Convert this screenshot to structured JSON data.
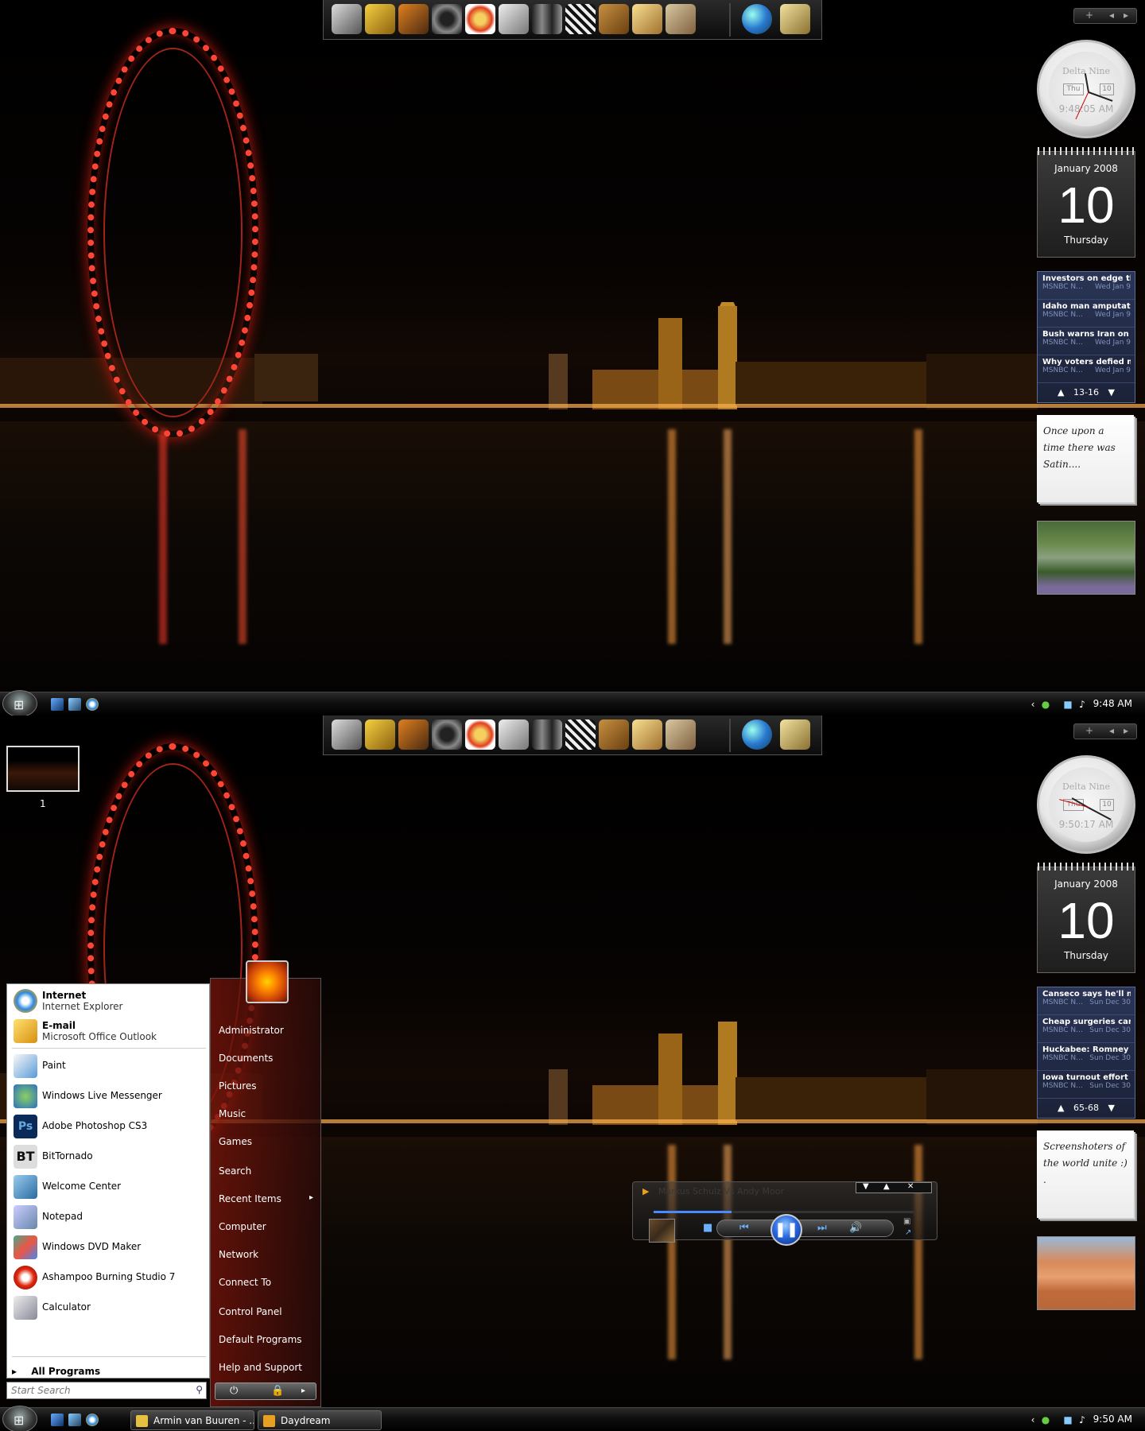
{
  "colors": {
    "accent": "#4a8aff",
    "eye": "#ff4636",
    "newsbg": "#2a3556"
  },
  "dock": {
    "icons": [
      "drive-icon",
      "keys-icon",
      "tv-icon",
      "camera-lens-icon",
      "poker-chip-icon",
      "binoculars-icon",
      "toolbox-icon",
      "clapper-icon",
      "briefcase-icon",
      "pictures-icon",
      "map-icon",
      "globe-icon",
      "notepad-icon"
    ]
  },
  "sidebar": {
    "add_label": "+",
    "prev_label": "◂",
    "next_label": "▸"
  },
  "top": {
    "clock": {
      "brand": "Delta Nine",
      "day": "Thu",
      "date": "10",
      "time": "9:48:05 AM"
    },
    "calendar": {
      "month": "January 2008",
      "day": "10",
      "weekday": "Thursday"
    },
    "news": {
      "items": [
        {
          "title": "Investors on edge thi...",
          "source": "MSNBC N...",
          "date": "Wed Jan 9"
        },
        {
          "title": "Idaho man amputate...",
          "source": "MSNBC N...",
          "date": "Wed Jan 9"
        },
        {
          "title": "Bush warns Iran on s...",
          "source": "MSNBC N...",
          "date": "Wed Jan 9"
        },
        {
          "title": "Why voters defied m...",
          "source": "MSNBC N...",
          "date": "Wed Jan 9"
        }
      ],
      "range": "13-16"
    },
    "note": "Once upon a time there was Satin....",
    "taskbar_time": "9:48 AM"
  },
  "bottom": {
    "workspace_label": "1",
    "clock": {
      "brand": "Delta Nine",
      "day": "Thu",
      "date": "10",
      "time": "9:50:17 AM"
    },
    "calendar": {
      "month": "January 2008",
      "day": "10",
      "weekday": "Thursday"
    },
    "news": {
      "items": [
        {
          "title": "Canseco says he'll na...",
          "source": "MSNBC N...",
          "date": "Sun Dec 30"
        },
        {
          "title": "Cheap surgeries can ...",
          "source": "MSNBC N...",
          "date": "Sun Dec 30"
        },
        {
          "title": "Huckabee: Romney '...",
          "source": "MSNBC N...",
          "date": "Sun Dec 30"
        },
        {
          "title": "Iowa turnout effort c...",
          "source": "MSNBC N...",
          "date": "Sun Dec 30"
        }
      ],
      "range": "65-68"
    },
    "note": "Screenshoters of the world unite :) .",
    "taskbar_time": "9:50 AM",
    "tasks": [
      "Armin van Buuren - ...",
      "Daydream"
    ]
  },
  "start_menu": {
    "pinned": [
      {
        "title": "Internet",
        "subtitle": "Internet Explorer",
        "icon": "ie-icon"
      },
      {
        "title": "E-mail",
        "subtitle": "Microsoft Office Outlook",
        "icon": "outlook-icon"
      }
    ],
    "recent": [
      {
        "label": "Paint",
        "icon": "paint-icon"
      },
      {
        "label": "Windows Live Messenger",
        "icon": "messenger-icon"
      },
      {
        "label": "Adobe Photoshop CS3",
        "icon": "photoshop-icon"
      },
      {
        "label": "BitTornado",
        "icon": "bittornado-icon"
      },
      {
        "label": "Welcome Center",
        "icon": "welcome-icon"
      },
      {
        "label": "Notepad",
        "icon": "notepad-icon"
      },
      {
        "label": "Windows DVD Maker",
        "icon": "dvd-maker-icon"
      },
      {
        "label": "Ashampoo Burning Studio 7",
        "icon": "burning-icon"
      },
      {
        "label": "Calculator",
        "icon": "calculator-icon"
      }
    ],
    "all_programs": "All Programs",
    "search_placeholder": "Start Search",
    "right": [
      "Administrator",
      "Documents",
      "Pictures",
      "Music",
      "Games",
      "Search",
      "Recent Items",
      "Computer",
      "Network",
      "Connect To",
      "Control Panel",
      "Default Programs",
      "Help and Support"
    ]
  },
  "media_player": {
    "title": "Markus Schulz Vs Andy Moor",
    "progress": 0.3
  }
}
